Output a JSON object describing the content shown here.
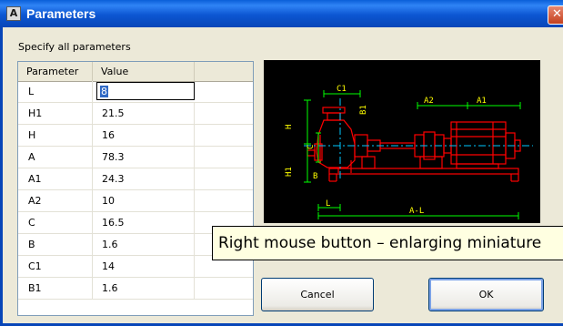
{
  "window": {
    "title": "Parameters",
    "app_icon_letter": "A",
    "close_symbol": "✕"
  },
  "instruction": "Specify all parameters",
  "grid": {
    "headers": [
      "Parameter",
      "Value",
      ""
    ],
    "rows": [
      {
        "param": "L",
        "value": "8",
        "editing": true
      },
      {
        "param": "H1",
        "value": "21.5"
      },
      {
        "param": "H",
        "value": "16"
      },
      {
        "param": "A",
        "value": "78.3"
      },
      {
        "param": "A1",
        "value": "24.3"
      },
      {
        "param": "A2",
        "value": "10"
      },
      {
        "param": "C",
        "value": "16.5"
      },
      {
        "param": "B",
        "value": "1.6"
      },
      {
        "param": "C1",
        "value": "14"
      },
      {
        "param": "B1",
        "value": "1.6"
      }
    ]
  },
  "preview": {
    "labels": {
      "c1": "C1",
      "b1": "B1",
      "a2": "A2",
      "a1": "A1",
      "h": "H",
      "c": "C",
      "h1": "H1",
      "b": "B",
      "l": "L",
      "a_minus_l": "A-L"
    },
    "colors": {
      "background": "#000000",
      "outline": "#ff0000",
      "dimension": "#00ff00",
      "centerline": "#00c8ff",
      "labels": "#ffff00"
    }
  },
  "tooltip": "Right mouse button – enlarging miniature",
  "buttons": {
    "cancel": "Cancel",
    "ok": "OK"
  }
}
